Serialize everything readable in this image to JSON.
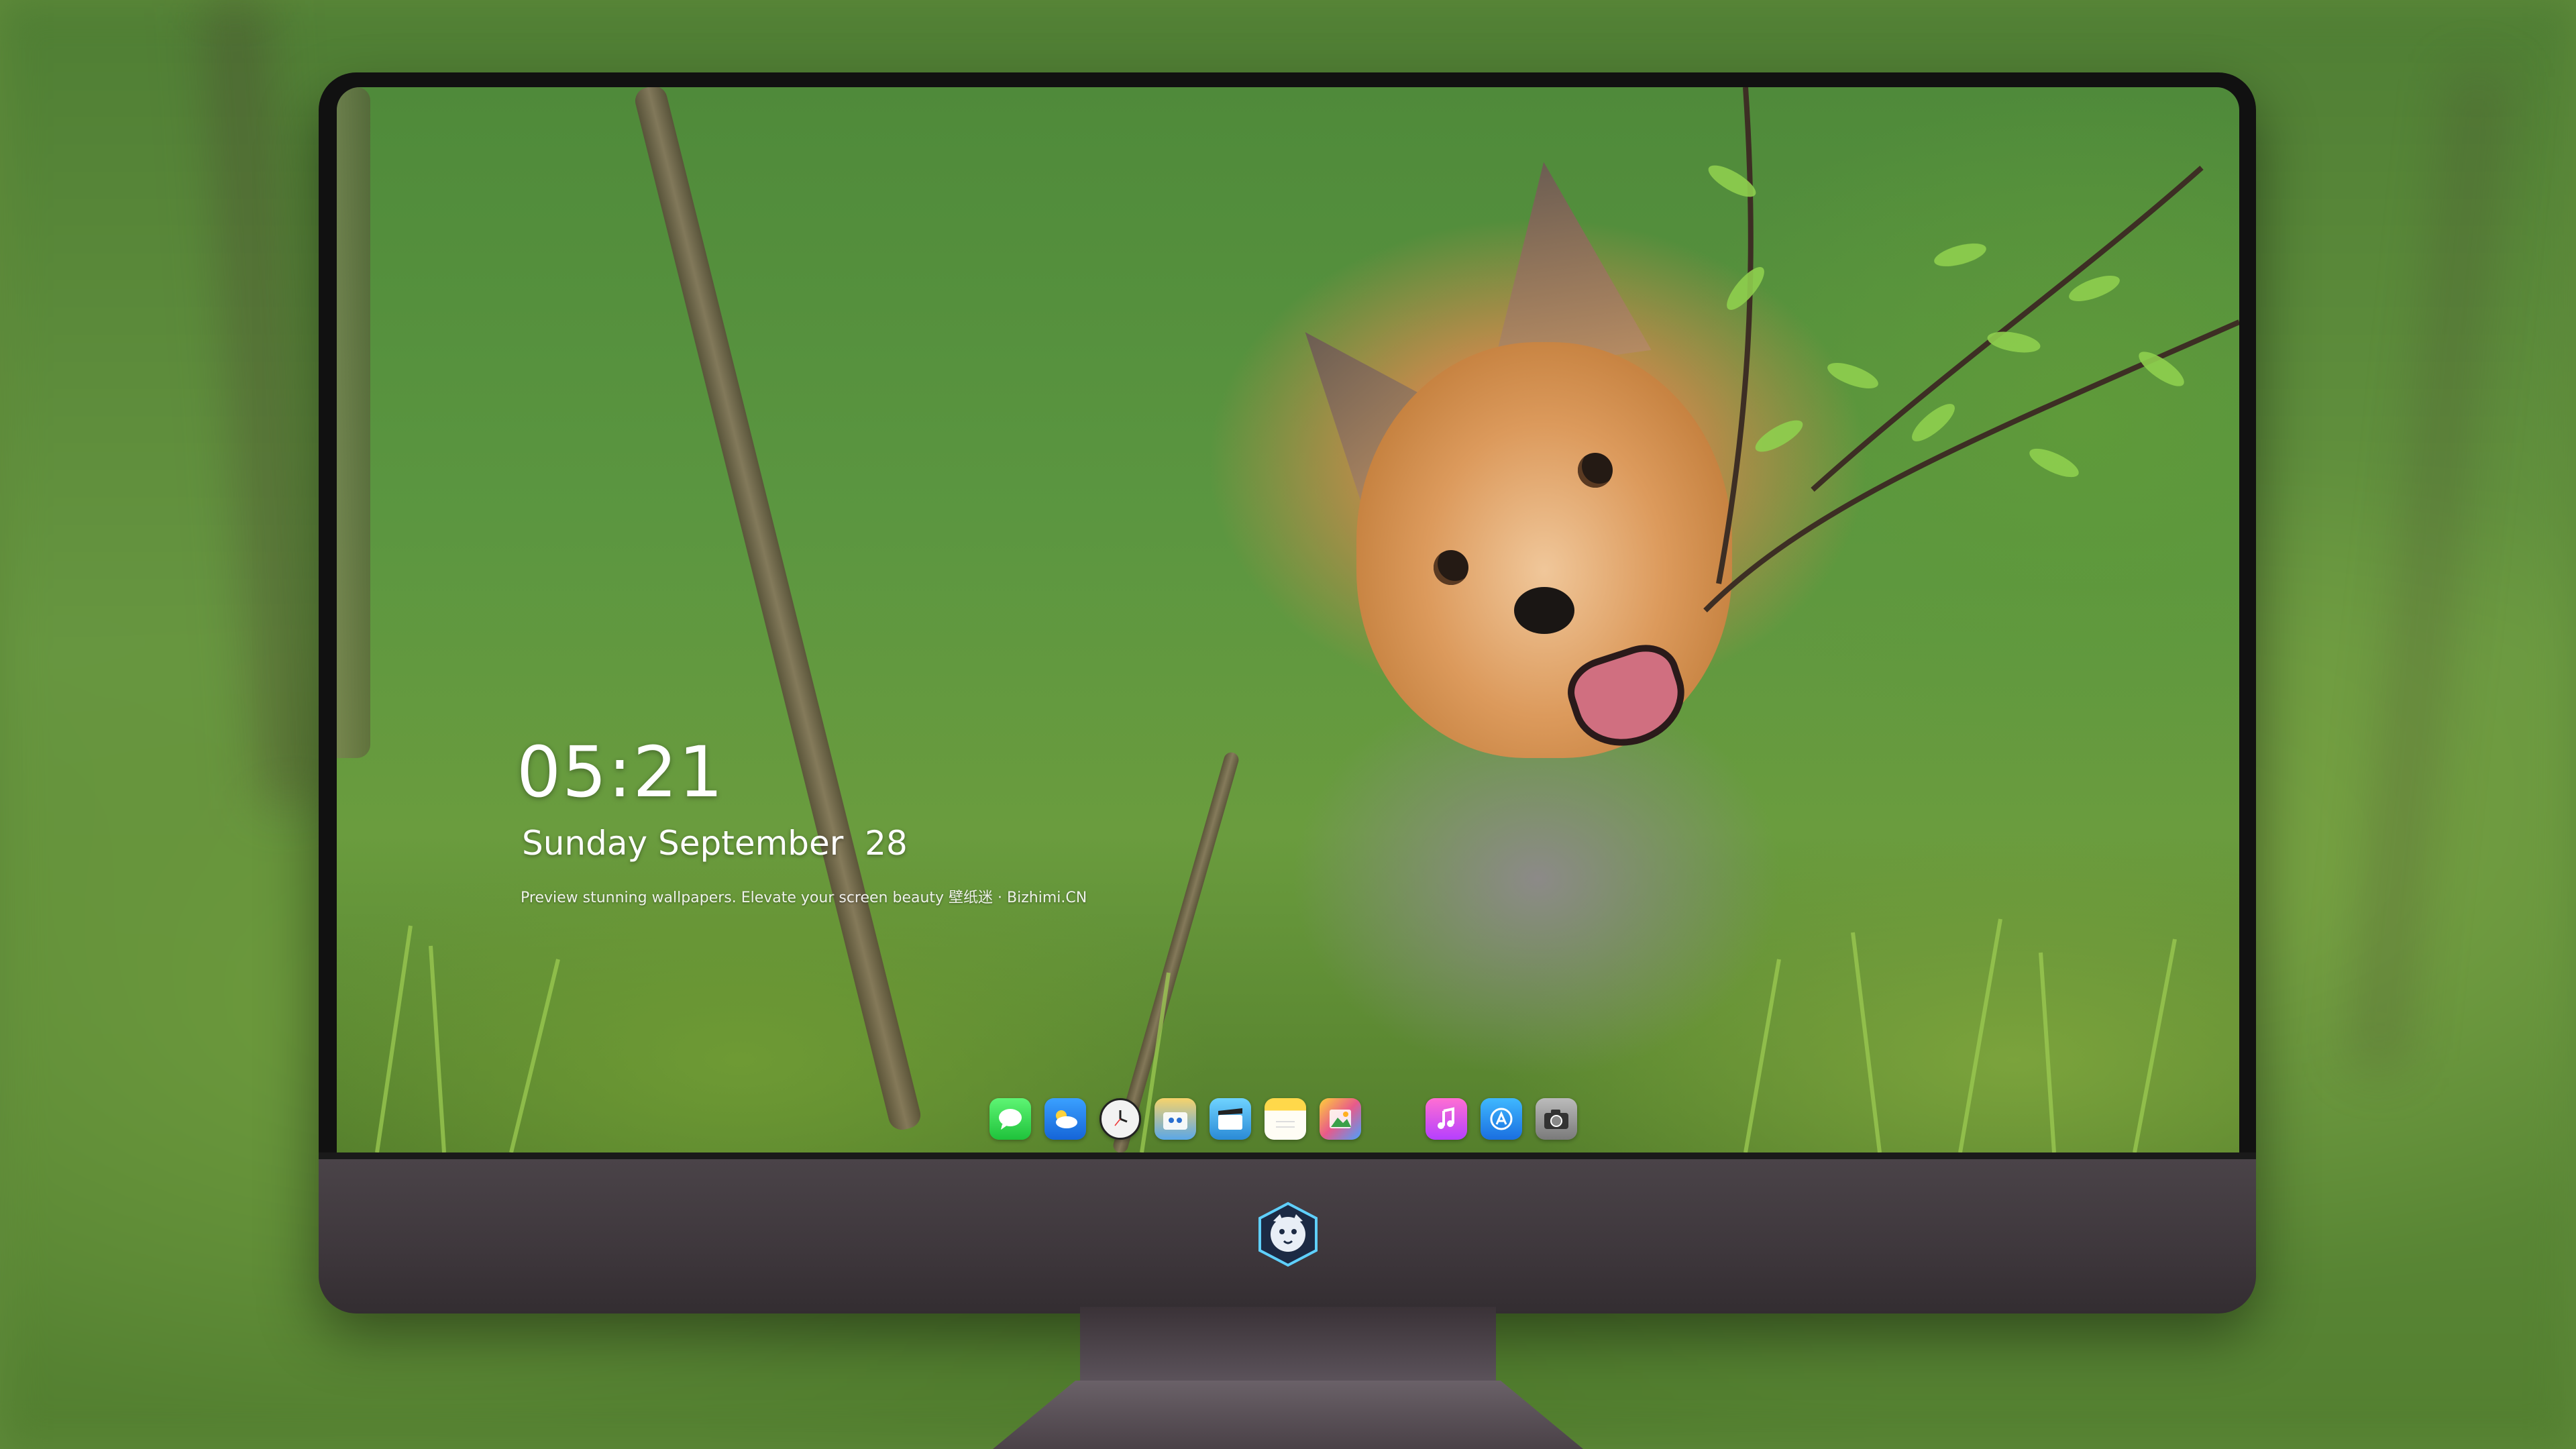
{
  "lockscreen": {
    "time": "05:21",
    "date": "Sunday September  28",
    "caption": "Preview stunning wallpapers. Elevate your screen beauty  壁纸迷 · Bizhimi.CN"
  },
  "dock": {
    "apps": [
      {
        "icon": "messages-icon"
      },
      {
        "icon": "weather-icon"
      },
      {
        "icon": "clock-icon"
      },
      {
        "icon": "finder-icon"
      },
      {
        "icon": "clips-icon"
      },
      {
        "icon": "notes-icon"
      },
      {
        "icon": "photos-icon"
      },
      {
        "icon": "music-icon"
      },
      {
        "icon": "app-store-icon"
      },
      {
        "icon": "camera-icon"
      }
    ]
  },
  "colors": {
    "bezel": "#111111",
    "chin": "#3e373c",
    "text": "#ffffff"
  }
}
